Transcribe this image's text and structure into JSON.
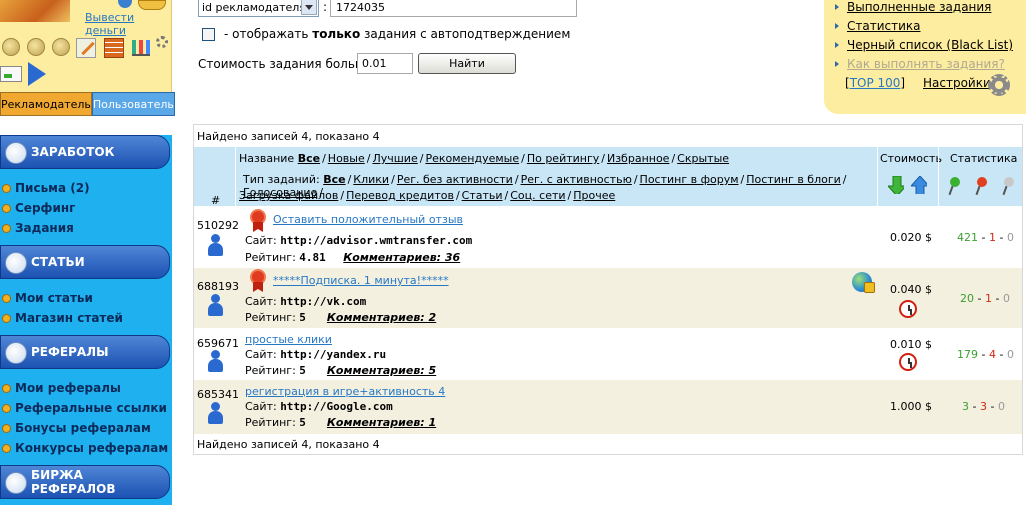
{
  "userbox": {
    "withdraw_link": "Вывести деньги",
    "tab_advertiser": "Рекламодатель",
    "tab_user": "Пользователь"
  },
  "sidebar": {
    "sections": [
      {
        "title": "ЗАРАБОТОК",
        "icon": "money-bag-icon",
        "items": [
          "Письма (2)",
          "Серфинг",
          "Задания"
        ]
      },
      {
        "title": "СТАТЬИ",
        "icon": "document-icon",
        "items": [
          "Мои статьи",
          "Магазин статей"
        ]
      },
      {
        "title": "РЕФЕРАЛЫ",
        "icon": "people-icon",
        "items": [
          "Мои рефералы",
          "Реферальные ссылки",
          "Бонусы рефералам",
          "Конкурсы рефералам"
        ]
      },
      {
        "title": "БИРЖА РЕФЕРАЛОВ",
        "icon": "referral-exchange-icon",
        "items": []
      }
    ]
  },
  "filter": {
    "select_value": "id рекламодателя",
    "colon": ":",
    "id_value": "1724035",
    "checkbox_prefix": "- отображать ",
    "checkbox_bold": "только",
    "checkbox_suffix": " задания с автоподтверждением",
    "cost_label": "Стоимость задания больше",
    "cost_value": "0.01",
    "find_button": "Найти"
  },
  "right_menu": {
    "links": [
      "Выполненные задания",
      "Статистика",
      "Черный список (Black List)"
    ],
    "help_link": "Как выполнять задания?",
    "top100_open": "[",
    "top100_label": "TOP 100",
    "top100_close": "]",
    "settings_label": "Настройки"
  },
  "results": {
    "found_text": "Найдено записей 4, показано 4",
    "header": {
      "hash": "#",
      "name_label": "Название",
      "name_filters": [
        "Все",
        "Новые",
        "Лучшие",
        "Рекомендуемые",
        "По рейтингу",
        "Избранное",
        "Скрытые"
      ],
      "type_label": "Тип заданий:",
      "type_filters_line1": [
        "Все",
        "Клики",
        "Рег. без активности",
        "Рег. с активностью",
        "Постинг в форум",
        "Постинг в блоги",
        "Голосование"
      ],
      "type_filters_line2": [
        "Загрузка файлов",
        "Перевод кредитов",
        "Статьи",
        "Соц. сети",
        "Прочее"
      ],
      "cost": "Стоимость",
      "stats": "Статистика"
    },
    "rows": [
      {
        "id": "510292",
        "title": "Оставить положительный отзыв",
        "site_label": "Сайт:",
        "site": "http://advisor.wmtransfer.com",
        "rating_label": "Рейтинг:",
        "rating": "4.81",
        "comments": "Комментариев: 36",
        "price": "0.020 $",
        "stat_ok": "421",
        "stat_bad": "1",
        "stat_wait": "0",
        "icons": [
          "ribbon-icon",
          "user-icon"
        ]
      },
      {
        "id": "688193",
        "title": "*****Подписка. 1 минута!*****",
        "site_label": "Сайт:",
        "site": "http://vk.com",
        "rating_label": "Рейтинг:",
        "rating": "5",
        "comments": "Комментариев: 2",
        "price": "0.040 $",
        "stat_ok": "20",
        "stat_bad": "1",
        "stat_wait": "0",
        "icons": [
          "ribbon-icon",
          "globe-lock-icon",
          "alarm-clock-icon",
          "user-icon"
        ]
      },
      {
        "id": "659671",
        "title": "простые клики",
        "site_label": "Сайт:",
        "site": "http://yandex.ru",
        "rating_label": "Рейтинг:",
        "rating": "5",
        "comments": "Комментариев: 5",
        "price": "0.010 $",
        "stat_ok": "179",
        "stat_bad": "4",
        "stat_wait": "0",
        "icons": [
          "alarm-clock-icon",
          "user-icon"
        ]
      },
      {
        "id": "685341",
        "title": "регистрация в игре+активность 4",
        "site_label": "Сайт:",
        "site": "http://Google.com",
        "rating_label": "Рейтинг:",
        "rating": "5",
        "comments": "Комментариев: 1",
        "price": "1.000 $",
        "stat_ok": "3",
        "stat_bad": "3",
        "stat_wait": "0",
        "icons": [
          "user-icon"
        ]
      }
    ],
    "stat_separator": "-",
    "colors": {
      "row_alt": "#f4f0e0",
      "header": "#c9e6f7",
      "menu_blue": "#1eb0ef",
      "panel_yellow": "#fdeda0"
    }
  }
}
